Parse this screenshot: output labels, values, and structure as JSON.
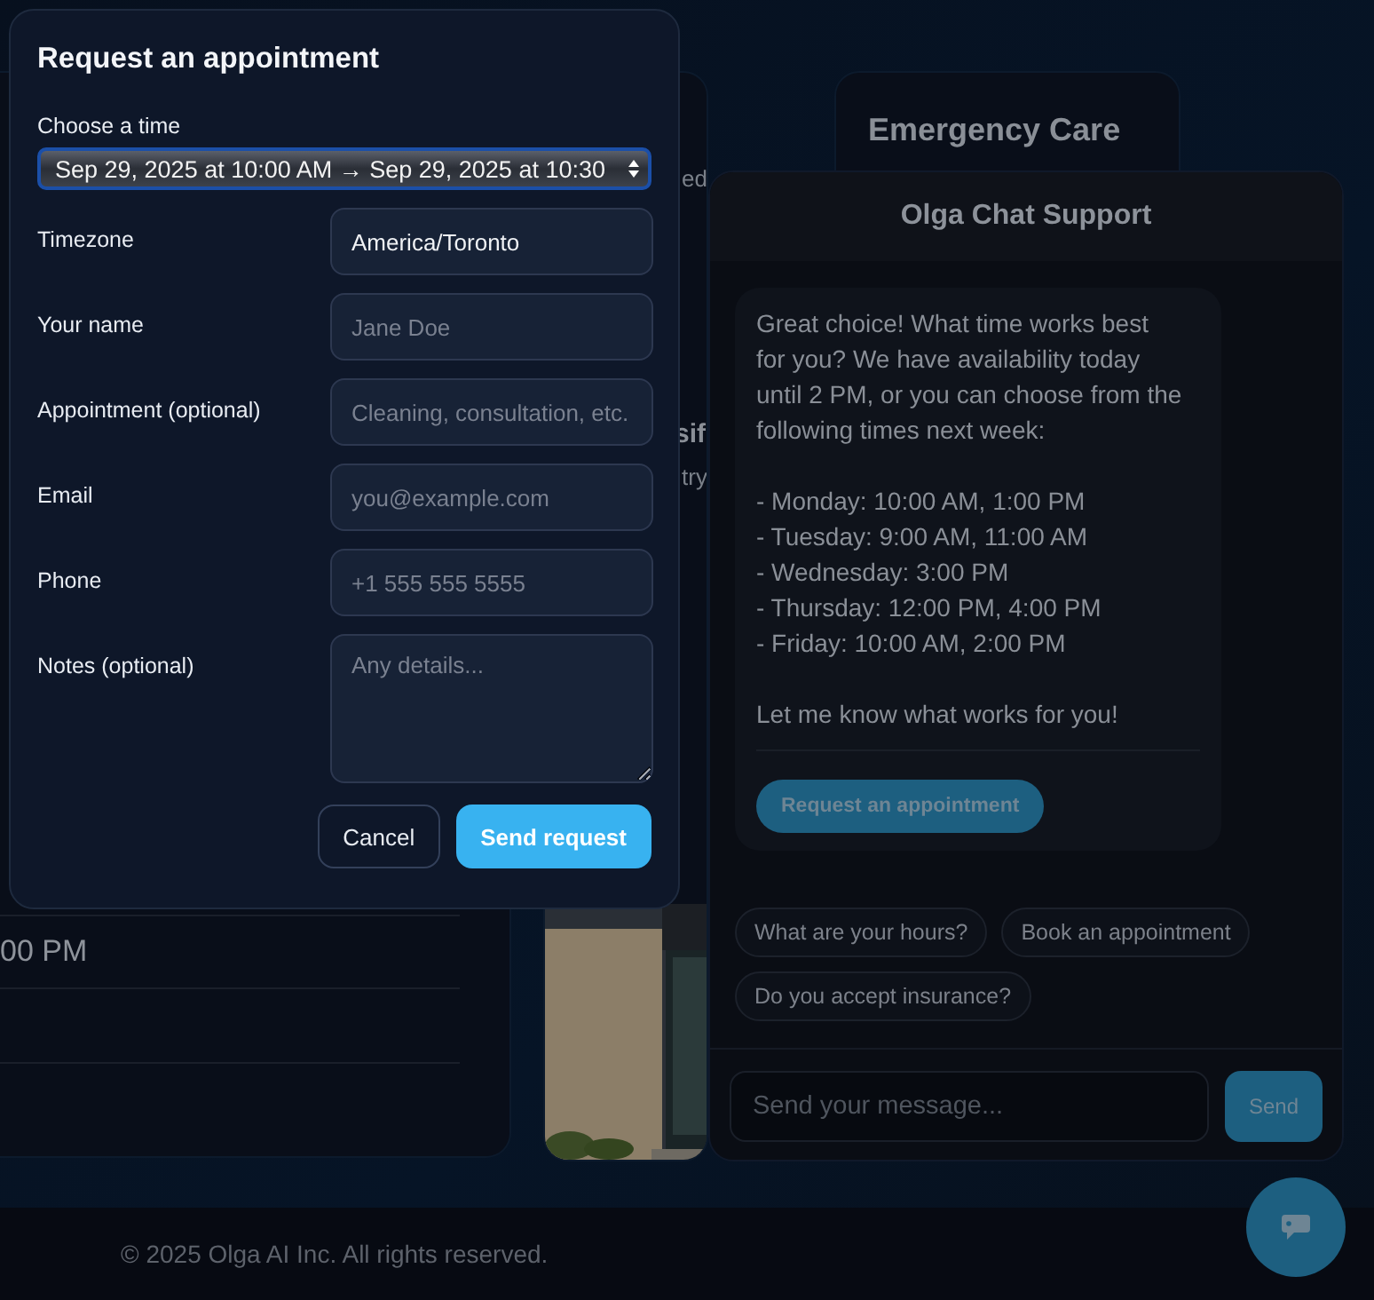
{
  "page": {
    "left_card": {
      "time_rows": [
        "00 PM"
      ]
    },
    "middle_card": {
      "texts": [
        {
          "kind": "plain",
          "text": "ed"
        },
        {
          "kind": "heading",
          "text": "sif"
        },
        {
          "kind": "plain",
          "text": "try"
        }
      ]
    },
    "right_card": {
      "title": "Emergency Care"
    },
    "footer": "© 2025 Olga AI Inc. All rights reserved."
  },
  "modal": {
    "title": "Request an appointment",
    "time_label": "Choose a time",
    "time_value": "Sep 29, 2025 at 10:00 AM → Sep 29, 2025 at 10:30",
    "fields": [
      {
        "kind": "input",
        "label": "Timezone",
        "value": "America/Toronto"
      },
      {
        "kind": "input",
        "label": "Your name",
        "placeholder": "Jane Doe"
      },
      {
        "kind": "input",
        "label": "Appointment (optional)",
        "placeholder": "Cleaning, consultation, etc."
      },
      {
        "kind": "input",
        "label": "Email",
        "placeholder": "you@example.com"
      },
      {
        "kind": "input",
        "label": "Phone",
        "placeholder": "+1 555 555 5555"
      },
      {
        "kind": "textarea",
        "label": "Notes (optional)",
        "placeholder": "Any details..."
      }
    ],
    "buttons": [
      {
        "kind": "secondary",
        "label": "Cancel"
      },
      {
        "kind": "primary",
        "label": "Send request"
      }
    ]
  },
  "chat": {
    "title": "Olga Chat Support",
    "message": {
      "text": "Great choice! What time works best for you? We have availability today until 2 PM, or you can choose from the following times next week:\n\n- Monday: 10:00 AM, 1:00 PM\n- Tuesday: 9:00 AM, 11:00 AM\n- Wednesday: 3:00 PM\n- Thursday: 12:00 PM, 4:00 PM\n- Friday: 10:00 AM, 2:00 PM\n\nLet me know what works for you!",
      "button": "Request an appointment"
    },
    "suggestions": [
      "What are your hours?",
      "Book an appointment",
      "Do you accept insurance?"
    ],
    "input": {
      "placeholder": "Send your message..."
    },
    "send_button": "Send"
  }
}
